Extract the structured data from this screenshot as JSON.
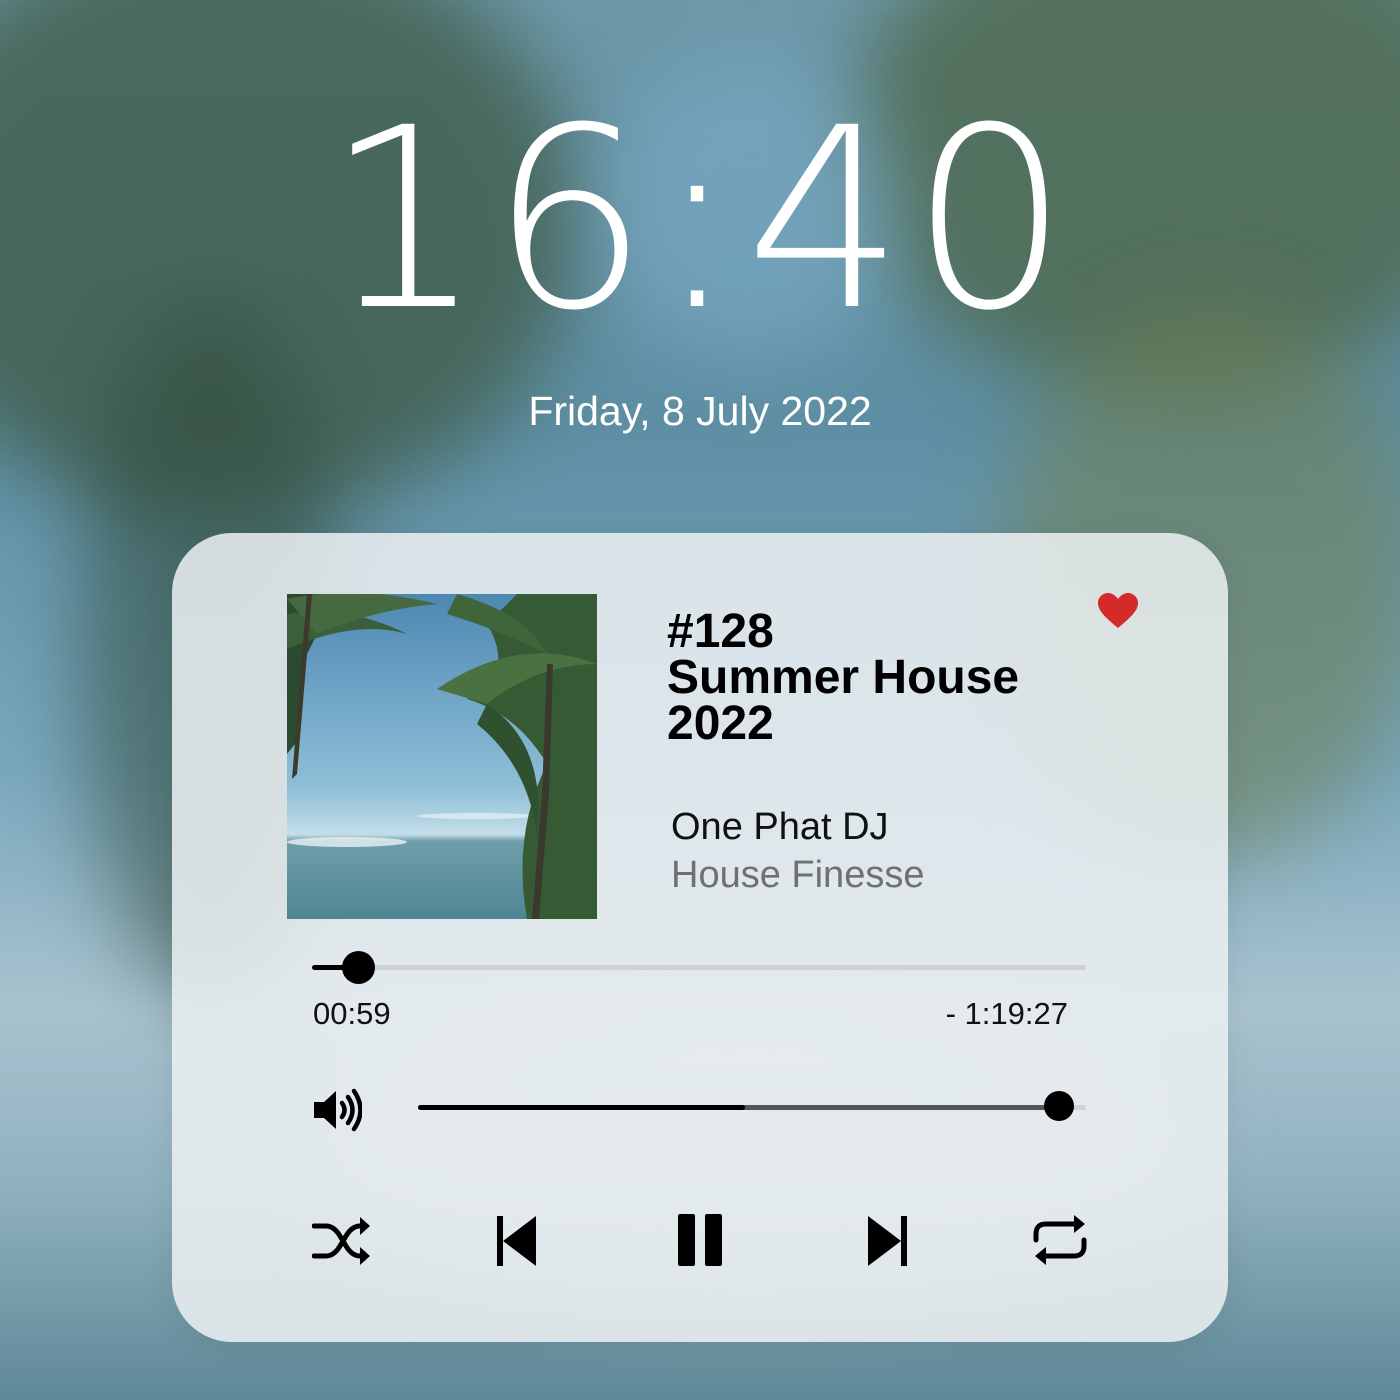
{
  "lockscreen": {
    "time": "16:40",
    "date": "Friday, 8 July 2022"
  },
  "player": {
    "title_lines": [
      "#128",
      "Summer House",
      "2022"
    ],
    "artist": "One Phat DJ",
    "album": "House Finesse",
    "favorite": true,
    "favorite_color": "#d42a2a",
    "elapsed": "00:59",
    "remaining": "- 1:19:27",
    "progress_fraction": 0.06,
    "volume_fraction": 0.96,
    "volume_secondary_fraction": 0.49,
    "controls": {
      "shuffle": "shuffle-icon",
      "previous": "skip-previous-icon",
      "play_pause": "pause-icon",
      "next": "skip-next-icon",
      "repeat": "repeat-icon"
    }
  }
}
